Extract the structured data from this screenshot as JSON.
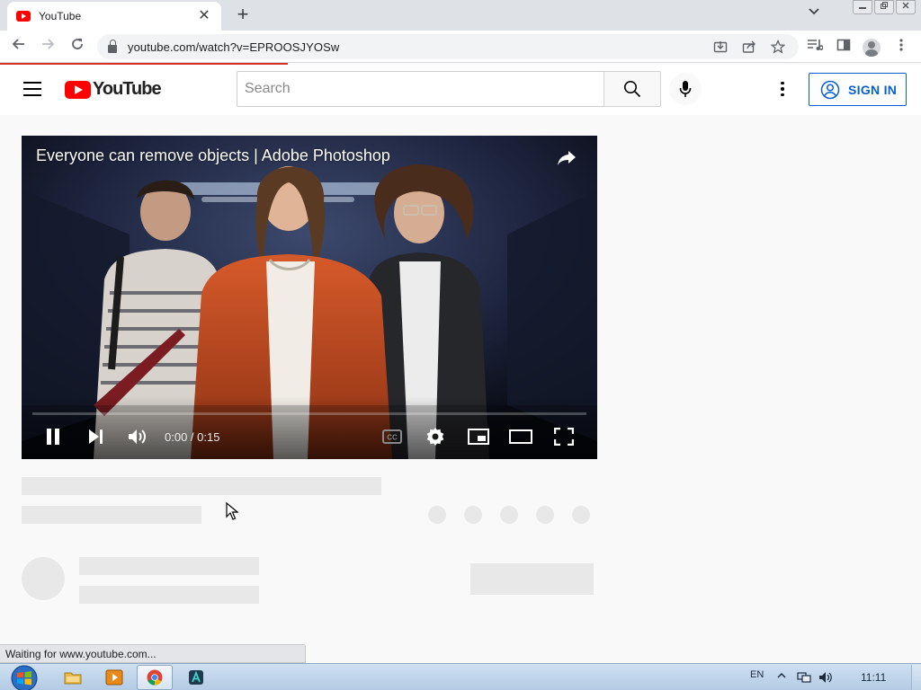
{
  "browser": {
    "tab_title": "YouTube",
    "tab_close": "✕",
    "new_tab": "+",
    "url": "youtube.com/watch?v=EPROOSJYOSw",
    "status_text": "Waiting for www.youtube.com..."
  },
  "header": {
    "logo_text": "YouTube",
    "search_placeholder": "Search",
    "sign_in_label": "SIGN IN"
  },
  "player": {
    "title": "Everyone can remove objects | Adobe Photoshop",
    "time": "0:00 / 0:15",
    "progress": 0.0,
    "cc_label": "CC"
  },
  "taskbar": {
    "language": "EN",
    "clock": "11:11"
  },
  "colors": {
    "brand_red": "#ff0000",
    "link_blue": "#065fd4",
    "loading_red": "#d93025"
  },
  "icons": [
    "back-icon",
    "forward-icon",
    "reload-icon",
    "lock-icon",
    "install-icon",
    "share-page-icon",
    "bookmark-star-icon",
    "reading-list-icon",
    "side-panel-icon",
    "profile-icon",
    "menu-icon",
    "hamburger-icon",
    "search-icon",
    "mic-icon",
    "more-vert-icon",
    "account-circle-icon",
    "share-icon",
    "pause-icon",
    "next-icon",
    "volume-icon",
    "cc-icon",
    "settings-icon",
    "miniplayer-icon",
    "theater-icon",
    "fullscreen-icon"
  ]
}
